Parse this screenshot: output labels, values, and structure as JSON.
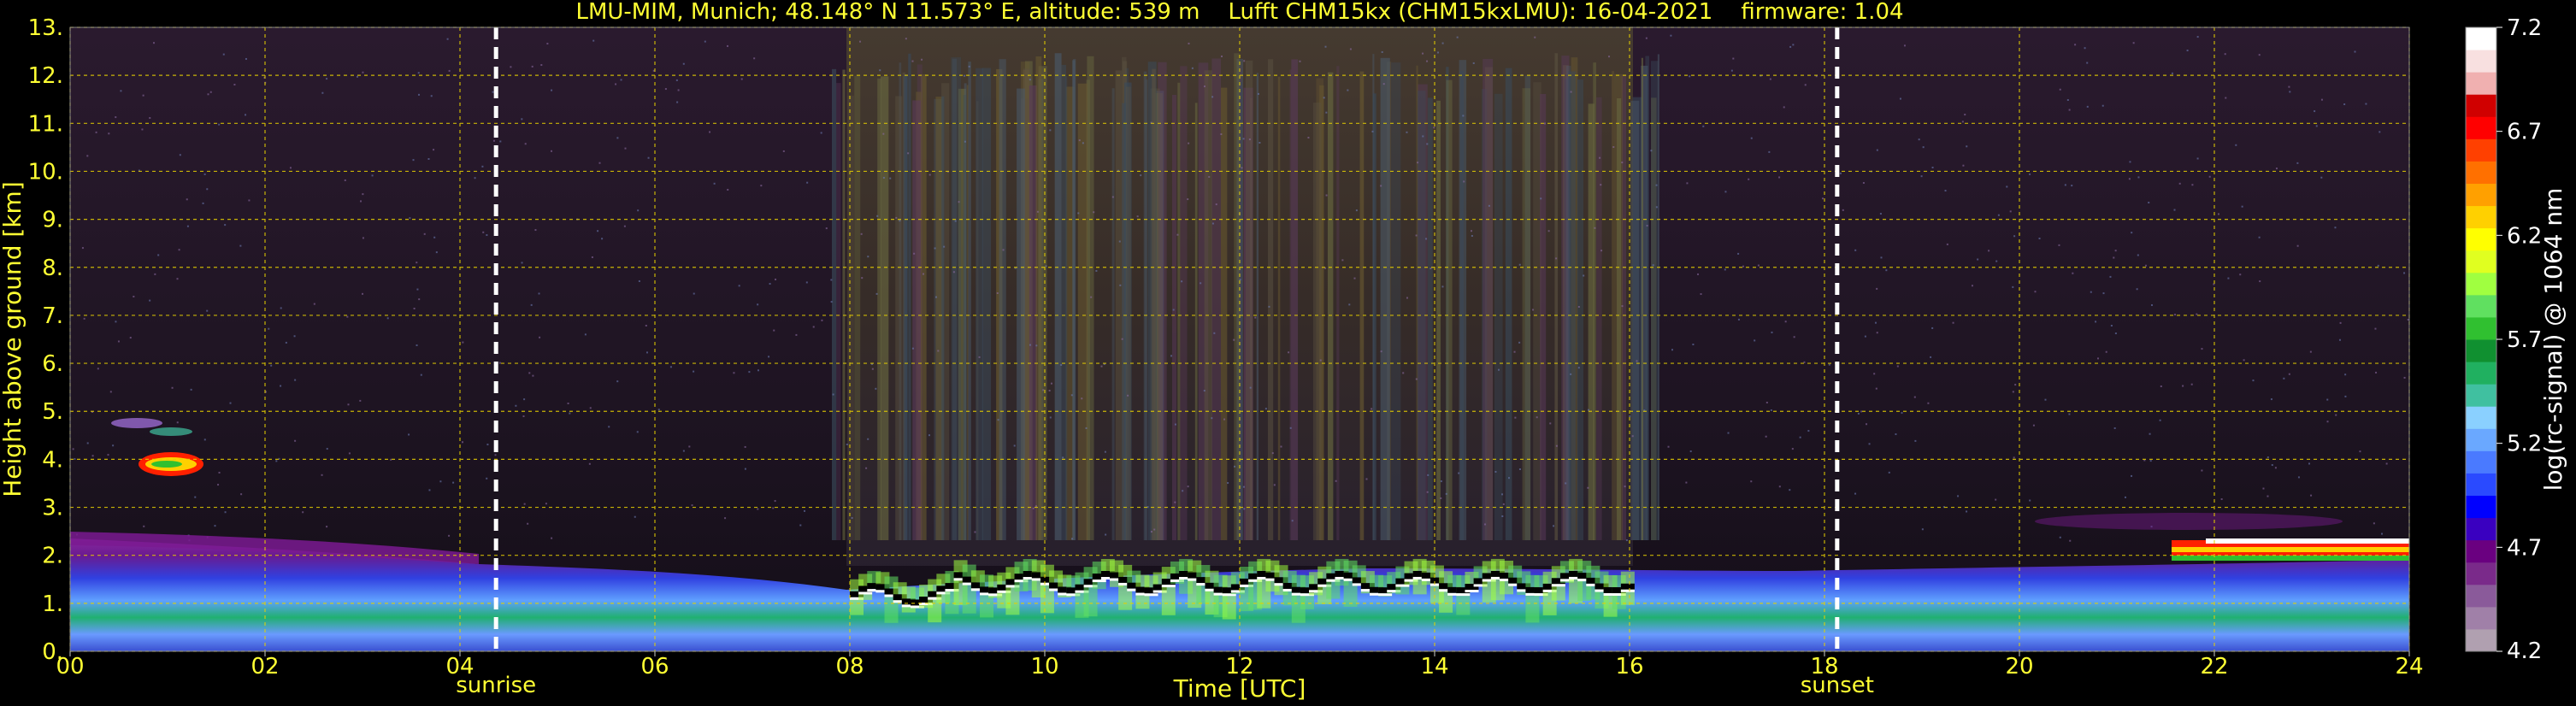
{
  "chart_data": {
    "type": "heatmap",
    "title": "LMU-MIM, Munich; 48.148° N 11.573° E, altitude: 539 m    Lufft CHM15kx (CHM15kxLMU): 16-04-2021    firmware: 1.04",
    "xlabel": "Time [UTC]",
    "ylabel": "Height above ground [km]",
    "xlim": [
      0,
      24
    ],
    "ylim": [
      0,
      13
    ],
    "x_ticks": [
      "00",
      "02",
      "04",
      "06",
      "08",
      "10",
      "12",
      "14",
      "16",
      "18",
      "20",
      "22",
      "24"
    ],
    "x_tick_values": [
      0,
      2,
      4,
      6,
      8,
      10,
      12,
      14,
      16,
      18,
      20,
      22,
      24
    ],
    "y_ticks": [
      "0.",
      "1.",
      "2.",
      "3.",
      "4.",
      "5.",
      "6.",
      "7.",
      "8.",
      "9.",
      "10.",
      "11.",
      "12.",
      "13."
    ],
    "y_tick_values": [
      0,
      1,
      2,
      3,
      4,
      5,
      6,
      7,
      8,
      9,
      10,
      11,
      12,
      13
    ],
    "grid": true,
    "events": [
      {
        "label": "sunrise",
        "time": 4.37
      },
      {
        "label": "sunset",
        "time": 18.13
      }
    ],
    "colorbar": {
      "label": "log(rc-signal) @ 1064 nm",
      "range": [
        4.2,
        7.2
      ],
      "ticks": [
        "4.2",
        "4.7",
        "5.2",
        "5.7",
        "6.2",
        "6.7",
        "7.2"
      ],
      "tick_values": [
        4.2,
        4.7,
        5.2,
        5.7,
        6.2,
        6.7,
        7.2
      ],
      "colors": [
        "#b0a0b0",
        "#a080a8",
        "#8a5a9a",
        "#7a2a8a",
        "#6a0080",
        "#3a00c0",
        "#0000ff",
        "#2a4aff",
        "#4a7aff",
        "#6aa8ff",
        "#8ad0ff",
        "#40c0a0",
        "#20b060",
        "#109030",
        "#30c030",
        "#60e060",
        "#a0ff40",
        "#e0ff20",
        "#ffff00",
        "#ffd000",
        "#ffa000",
        "#ff7000",
        "#ff4000",
        "#ff0000",
        "#d00000",
        "#f0b0b0",
        "#f8e0e0",
        "#ffffff"
      ]
    },
    "features": [
      {
        "name": "boundary layer",
        "time_start": 0,
        "time_end": 24,
        "height_top_km": 1.8
      },
      {
        "name": "elevated aerosol layer",
        "time_start": 0,
        "time_end": 4,
        "height_top_km": 2.4
      },
      {
        "name": "cloud",
        "time_start": 0.6,
        "time_end": 1.3,
        "height_km": 4.0
      },
      {
        "name": "cloud",
        "time_start": 0.4,
        "time_end": 1.0,
        "height_km": 4.9
      },
      {
        "name": "boundary layer clouds",
        "time_start": 8.0,
        "time_end": 16.0,
        "height_km": 1.5
      },
      {
        "name": "cloud layer",
        "time_start": 21.5,
        "time_end": 24,
        "height_km": 2.1
      }
    ]
  }
}
